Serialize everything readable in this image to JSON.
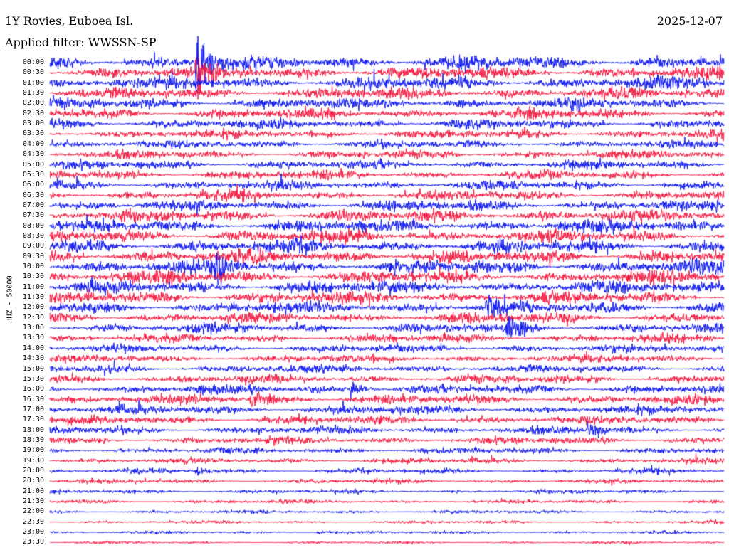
{
  "header": {
    "station": "1Y Rovies, Euboea Isl.",
    "date": "2025-12-07",
    "filter": "Applied filter: WWSSN-SP"
  },
  "axis": {
    "ylabel": "HHZ - 50000"
  },
  "colors": {
    "trace_a": "#0a14f0",
    "trace_b": "#f5143c",
    "background": "#ffffff"
  },
  "chart_data": {
    "type": "line",
    "title": "1Y Rovies, Euboea Isl.",
    "subtitle": "Applied filter: WWSSN-SP",
    "ylabel": "HHZ - 50000",
    "row_labels": [
      "00:00",
      "00:30",
      "01:00",
      "01:30",
      "02:00",
      "02:30",
      "03:00",
      "03:30",
      "04:00",
      "04:30",
      "05:00",
      "05:30",
      "06:00",
      "06:30",
      "07:00",
      "07:30",
      "08:00",
      "08:30",
      "09:00",
      "09:30",
      "10:00",
      "10:30",
      "11:00",
      "11:30",
      "12:00",
      "12:30",
      "13:00",
      "13:30",
      "14:00",
      "14:30",
      "15:00",
      "15:30",
      "16:00",
      "16:30",
      "17:00",
      "17:30",
      "18:00",
      "18:30",
      "19:00",
      "19:30",
      "20:00",
      "20:30",
      "21:00",
      "21:30",
      "22:00",
      "22:30",
      "23:00",
      "23:30"
    ],
    "trace_colors": [
      "#0a14f0",
      "#f5143c"
    ],
    "relative_amplitude": [
      1.5,
      1.4,
      1.4,
      1.3,
      1.2,
      1.15,
      1.1,
      1.0,
      0.9,
      0.95,
      1.0,
      1.0,
      1.05,
      1.1,
      1.2,
      1.3,
      1.35,
      1.4,
      1.45,
      1.5,
      1.5,
      1.45,
      1.4,
      1.35,
      1.3,
      1.2,
      1.1,
      0.95,
      0.9,
      0.85,
      0.9,
      0.95,
      1.0,
      1.05,
      1.0,
      0.95,
      0.9,
      0.8,
      0.7,
      0.65,
      0.6,
      0.55,
      0.5,
      0.45,
      0.4,
      0.35,
      0.35,
      0.3
    ],
    "events": [
      {
        "row": 0,
        "x_fraction": 0.22,
        "amplitude": 5.0
      },
      {
        "row": 1,
        "x_fraction": 0.22,
        "amplitude": 3.0
      },
      {
        "row": 20,
        "x_fraction": 0.25,
        "amplitude": 2.0
      },
      {
        "row": 24,
        "x_fraction": 0.65,
        "amplitude": 2.0
      },
      {
        "row": 26,
        "x_fraction": 0.68,
        "amplitude": 2.0
      },
      {
        "row": 32,
        "x_fraction": 0.45,
        "amplitude": 2.0
      },
      {
        "row": 33,
        "x_fraction": 0.3,
        "amplitude": 1.5
      },
      {
        "row": 36,
        "x_fraction": 0.8,
        "amplitude": 1.5
      },
      {
        "row": 40,
        "x_fraction": 0.22,
        "amplitude": 1.5
      },
      {
        "row": 46,
        "x_fraction": 0.4,
        "amplitude": 1.0
      }
    ],
    "grid": false,
    "legend": "none"
  }
}
